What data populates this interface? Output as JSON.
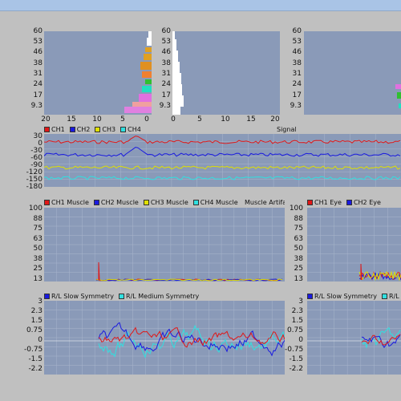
{
  "colors": {
    "plot_bg": "#8a9ab8",
    "grid": "#a9b6cc",
    "ch1": "#e01818",
    "ch2": "#1a1ae0",
    "ch3": "#e0e000",
    "ch4": "#30e0e0",
    "white": "#ffffff"
  },
  "histograms": {
    "y_ticks": [
      "60",
      "53",
      "46",
      "38",
      "31",
      "24",
      "17",
      "9.3"
    ],
    "x_ticks": [
      "20",
      "15",
      "10",
      "5",
      "0"
    ],
    "x_ticks_b": [
      "0",
      "5",
      "10",
      "15",
      "20"
    ]
  },
  "signal": {
    "title": "Signal",
    "legend": [
      "CH1",
      "CH2",
      "CH3",
      "CH4"
    ],
    "y_ticks": [
      "30",
      "0",
      "-30",
      "-60",
      "-90",
      "-120",
      "-150",
      "-180"
    ]
  },
  "muscle": {
    "title": "Muscle Artifact",
    "legend": [
      "CH1 Muscle",
      "CH2 Muscle",
      "CH3 Muscle",
      "CH4 Muscle"
    ],
    "y_ticks": [
      "100",
      "88",
      "75",
      "63",
      "50",
      "38",
      "25",
      "13"
    ]
  },
  "eye": {
    "legend": [
      "CH1 Eye",
      "CH2 Eye"
    ],
    "y_ticks": [
      "100",
      "88",
      "75",
      "63",
      "50",
      "38",
      "25",
      "13"
    ]
  },
  "symmetry": {
    "legend": [
      "R/L Slow Symmetry",
      "R/L Medium Symmetry"
    ],
    "y_ticks": [
      "3",
      "2.3",
      "1.5",
      "0.75",
      "0",
      "-0.75",
      "-1.5",
      "-2.2"
    ]
  },
  "symmetry_b": {
    "legend": [
      "R/L Slow Symmetry",
      "R/L Medium"
    ],
    "y_ticks": [
      "3",
      "2.3",
      "1.5",
      "0.75",
      "0",
      "-0.75",
      "-1.5",
      "-2.2"
    ]
  }
}
